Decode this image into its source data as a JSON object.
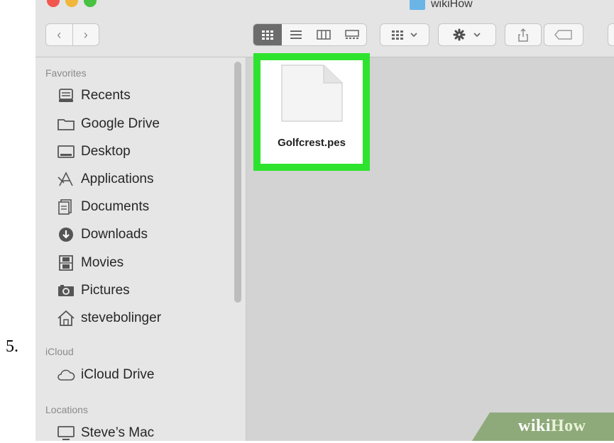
{
  "step_number": "5.",
  "window": {
    "title": "wikiHow"
  },
  "toolbar": {
    "back_glyph": "‹",
    "forward_glyph": "›",
    "views": [
      "icon-view",
      "list-view",
      "column-view",
      "gallery-view"
    ],
    "selected_view": "icon-view",
    "group_button": "grid-icon",
    "action_button": "gear-icon",
    "share_button": "share-icon",
    "tag_button": "tag-icon"
  },
  "sidebar": {
    "favorites_label": "Favorites",
    "favorites": [
      {
        "label": "Recents",
        "icon": "recents-icon"
      },
      {
        "label": "Google Drive",
        "icon": "folder-icon"
      },
      {
        "label": "Desktop",
        "icon": "desktop-icon"
      },
      {
        "label": "Applications",
        "icon": "applications-icon"
      },
      {
        "label": "Documents",
        "icon": "documents-icon"
      },
      {
        "label": "Downloads",
        "icon": "downloads-icon"
      },
      {
        "label": "Movies",
        "icon": "movies-icon"
      },
      {
        "label": "Pictures",
        "icon": "pictures-icon"
      },
      {
        "label": "stevebolinger",
        "icon": "home-icon"
      }
    ],
    "icloud_label": "iCloud",
    "icloud": [
      {
        "label": "iCloud Drive",
        "icon": "cloud-icon"
      }
    ],
    "locations_label": "Locations",
    "locations": [
      {
        "label": "Steve’s Mac",
        "icon": "computer-icon"
      }
    ]
  },
  "content": {
    "file": {
      "name": "Golfcrest.pes",
      "icon": "document-icon",
      "highlight_color": "#2ee32e"
    }
  },
  "watermark": {
    "wiki": "wiki",
    "how": "How"
  }
}
